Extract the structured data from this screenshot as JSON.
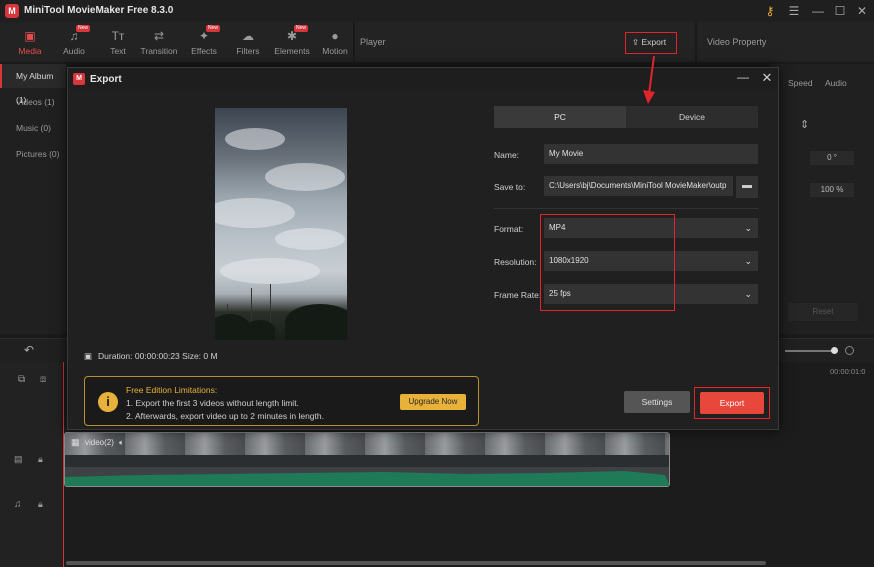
{
  "app": {
    "logo_letter": "M",
    "title": "MiniTool MovieMaker Free 8.3.0"
  },
  "window_controls": {
    "key": "⚷",
    "menu": "☰",
    "minimize": "—",
    "maximize": "☐",
    "close": "✕"
  },
  "toolbar": [
    {
      "label": "Media",
      "icon": "media-icon",
      "glyph": "▣",
      "new": false,
      "active": true
    },
    {
      "label": "Audio",
      "icon": "audio-icon",
      "glyph": "♫",
      "new": true,
      "active": false
    },
    {
      "label": "Text",
      "icon": "text-icon",
      "glyph": "Tт",
      "new": false,
      "active": false
    },
    {
      "label": "Transition",
      "icon": "transition-icon",
      "glyph": "⇄",
      "new": false,
      "active": false
    },
    {
      "label": "Effects",
      "icon": "effects-icon",
      "glyph": "✦",
      "new": true,
      "active": false
    },
    {
      "label": "Filters",
      "icon": "filters-icon",
      "glyph": "☁",
      "new": false,
      "active": false
    },
    {
      "label": "Elements",
      "icon": "elements-icon",
      "glyph": "✱",
      "new": true,
      "active": false
    },
    {
      "label": "Motion",
      "icon": "motion-icon",
      "glyph": "●",
      "new": false,
      "active": false
    }
  ],
  "new_badge": "New",
  "player": {
    "label": "Player",
    "export_label": "Export"
  },
  "property": {
    "label": "Video Property",
    "tabs": [
      "Speed",
      "Audio"
    ],
    "rotation_value": "0 °",
    "scale_value": "100 %",
    "reset_label": "Reset"
  },
  "library": [
    "My Album (1)",
    "Videos (1)",
    "Music (0)",
    "Pictures (0)"
  ],
  "timeline": {
    "clip_label": "video(2)",
    "time_mark": "00:00:01:0"
  },
  "dialog": {
    "logo_letter": "M",
    "title": "Export",
    "tabs": {
      "pc": "PC",
      "device": "Device"
    },
    "name": {
      "label": "Name:",
      "value": "My Movie"
    },
    "save_to": {
      "label": "Save to:",
      "value": "C:\\Users\\bj\\Documents\\MiniTool MovieMaker\\outp"
    },
    "format": {
      "label": "Format:",
      "value": "MP4"
    },
    "resolution": {
      "label": "Resolution:",
      "value": "1080x1920"
    },
    "frame_rate": {
      "label": "Frame Rate:",
      "value": "25 fps"
    },
    "duration_text": "Duration:  00:00:00:23  Size:  0 M",
    "limitations": {
      "title": "Free Edition Limitations:",
      "line1": "1. Export the first 3 videos without length limit.",
      "line2": "2. Afterwards, export video up to 2 minutes in length.",
      "upgrade_label": "Upgrade Now"
    },
    "settings_label": "Settings",
    "export_label": "Export"
  },
  "colors": {
    "accent_red": "#e0252c",
    "export_button": "#e8483c",
    "warning_gold": "#e8b13a",
    "audio_track": "#1f7a58"
  }
}
